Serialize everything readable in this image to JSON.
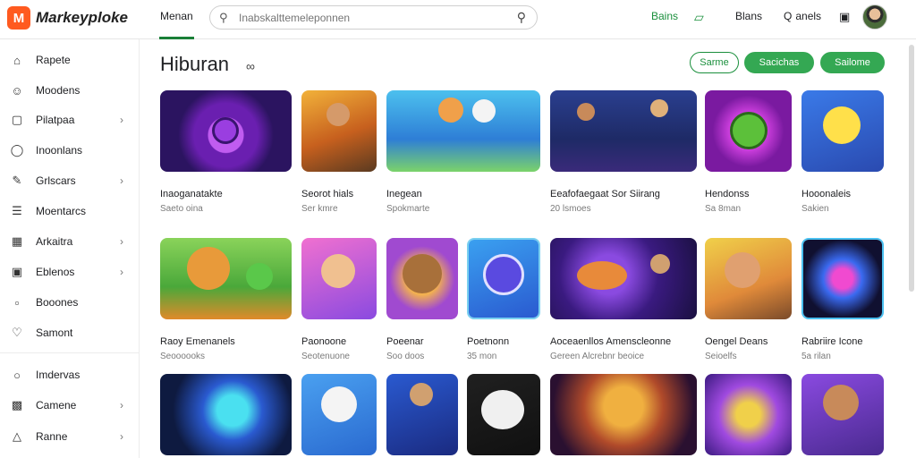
{
  "app": {
    "logo_text": "Markeyploke",
    "nav_home": "Menan",
    "search_placeholder": "Inabskalttemeleponnen",
    "top_items": [
      {
        "icon": "tag-icon",
        "label": "Bains"
      },
      {
        "icon": "gift-icon",
        "label": ""
      },
      {
        "icon": "people-icon",
        "label": "Blans"
      },
      {
        "icon": "search-icon",
        "label": "anels"
      },
      {
        "icon": "clipboard-icon",
        "label": ""
      }
    ]
  },
  "sidebar": {
    "items": [
      {
        "icon": "home-icon",
        "label": "Rapete",
        "chevron": false
      },
      {
        "icon": "users-icon",
        "label": "Moodens",
        "chevron": false
      },
      {
        "icon": "ticket-icon",
        "label": "Pilatpaa",
        "chevron": true
      },
      {
        "icon": "bulb-icon",
        "label": "Inoonlans",
        "chevron": false
      },
      {
        "icon": "brush-icon",
        "label": "Grlscars",
        "chevron": true
      },
      {
        "icon": "list-icon",
        "label": "Moentarcs",
        "chevron": false
      },
      {
        "icon": "chart-icon",
        "label": "Arkaitra",
        "chevron": true
      },
      {
        "icon": "lock-icon",
        "label": "Eblenos",
        "chevron": true
      },
      {
        "icon": "clipboard-icon",
        "label": "Booones",
        "chevron": false
      },
      {
        "icon": "heart-icon",
        "label": "Samont",
        "chevron": false
      },
      {
        "icon": "chat-icon",
        "label": "Imdervas",
        "chevron": false
      },
      {
        "icon": "gamepad-icon",
        "label": "Camene",
        "chevron": true
      },
      {
        "icon": "person-icon",
        "label": "Ranne",
        "chevron": true
      }
    ]
  },
  "main": {
    "title": "Hiburan",
    "buttons": {
      "filter": "Sarme",
      "primary1": "Sacichas",
      "primary2": "Sailome"
    },
    "rows": [
      [
        {
          "title": "Inaoganatakte",
          "sub": "Saeto oina"
        },
        {
          "title": "Seorot hials",
          "sub": "Ser kmre"
        },
        {
          "title": "Inegean",
          "sub": "Spokmarte"
        },
        {
          "title": "Eeafofaegaat Sor Siirang",
          "sub": "20 lsmoes"
        },
        {
          "title": "Hendonss",
          "sub": "Sa 8man"
        },
        {
          "title": "Hooonaleis",
          "sub": "Sakien"
        }
      ],
      [
        {
          "title": "Raoy Emenanels",
          "sub": "Seoooooks"
        },
        {
          "title": "Paonoone",
          "sub": "Seotenuone"
        },
        {
          "title": "Poeenar",
          "sub": "Soo doos"
        },
        {
          "title": "Poetnonn",
          "sub": "35 mon"
        },
        {
          "title": "Aoceaenllos Amenscleonne",
          "sub": "Gereen Alcrebnr beoice"
        },
        {
          "title": "Oengel Deans",
          "sub": "Seioelfs"
        },
        {
          "title": "Rabriire Icone",
          "sub": "5a rilan"
        }
      ],
      [
        {
          "title": "",
          "sub": ""
        },
        {
          "title": "",
          "sub": ""
        },
        {
          "title": "",
          "sub": ""
        },
        {
          "title": "",
          "sub": ""
        },
        {
          "title": "",
          "sub": ""
        },
        {
          "title": "",
          "sub": ""
        },
        {
          "title": "",
          "sub": ""
        }
      ]
    ]
  },
  "colors": {
    "accent": "#34a853",
    "logo": "#ff5a1f"
  }
}
